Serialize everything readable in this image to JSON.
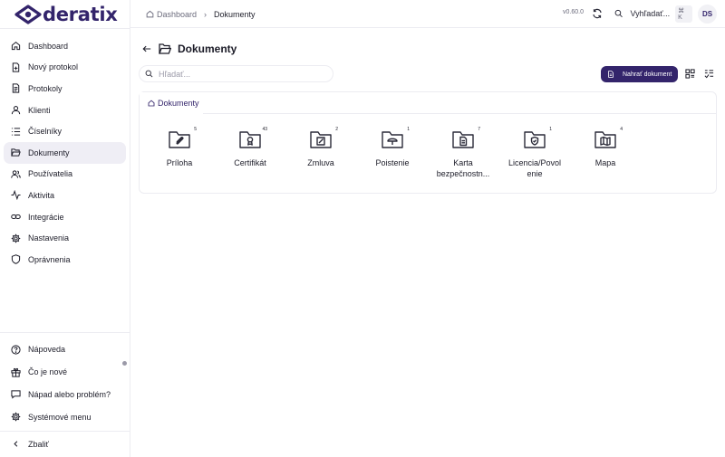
{
  "app": {
    "logo_text": "deratix",
    "version": "v0.60.0",
    "user_initials": "DS"
  },
  "topbar": {
    "breadcrumb": [
      {
        "label": "Dashboard"
      },
      {
        "label": "Dokumenty"
      }
    ],
    "search_label": "Vyhľadať...",
    "search_kbd": "⌘ K"
  },
  "sidebar": {
    "items": [
      {
        "label": "Dashboard",
        "icon": "home-icon"
      },
      {
        "label": "Nový protokol",
        "icon": "file-plus-icon"
      },
      {
        "label": "Protokoly",
        "icon": "file-text-icon"
      },
      {
        "label": "Klienti",
        "icon": "user-icon"
      },
      {
        "label": "Číselníky",
        "icon": "list-icon"
      },
      {
        "label": "Dokumenty",
        "icon": "folder-open-icon",
        "active": true
      },
      {
        "label": "Používatelia",
        "icon": "users-icon"
      },
      {
        "label": "Aktivita",
        "icon": "activity-icon"
      },
      {
        "label": "Integrácie",
        "icon": "link-icon"
      },
      {
        "label": "Nastavenia",
        "icon": "gear-icon"
      },
      {
        "label": "Oprávnenia",
        "icon": "shield-icon"
      }
    ],
    "bottom_items": [
      {
        "label": "Nápoveda",
        "icon": "help-icon"
      },
      {
        "label": "Čo je nové",
        "icon": "gift-icon"
      },
      {
        "label": "Nápad alebo problém?",
        "icon": "message-icon"
      },
      {
        "label": "Systémové menu",
        "icon": "gear-icon"
      }
    ],
    "collapse_label": "Zbaliť"
  },
  "main": {
    "title": "Dokumenty",
    "search_placeholder": "Hľadať...",
    "upload_label": "Nahrať dokument",
    "panel_tab": "Dokumenty",
    "folders": [
      {
        "label": "Príloha",
        "count": "5",
        "icon": "paperclip-icon"
      },
      {
        "label": "Certifikát",
        "count": "43",
        "icon": "award-icon"
      },
      {
        "label": "Zmluva",
        "count": "2",
        "icon": "pen-icon"
      },
      {
        "label": "Poistenie",
        "count": "1",
        "icon": "umbrella-icon"
      },
      {
        "label": "Karta bezpečnostn...",
        "count": "7",
        "icon": "document-icon"
      },
      {
        "label": "Licencia/Povolenie",
        "count": "1",
        "icon": "shield-check-icon"
      },
      {
        "label": "Mapa",
        "count": "4",
        "icon": "map-icon"
      }
    ]
  },
  "colors": {
    "brand": "#33246b",
    "active_nav": "#efeef5",
    "border": "#ececf1"
  }
}
